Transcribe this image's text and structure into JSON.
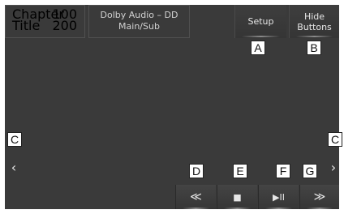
{
  "info": {
    "chapter_label": "Chapter",
    "chapter_value": "100",
    "title_label": "Title",
    "title_value": "200"
  },
  "audio": {
    "line1": "Dolby Audio – DD",
    "line2": "Main/Sub"
  },
  "buttons": {
    "setup": "Setup",
    "hide_line1": "Hide",
    "hide_line2": "Buttons"
  },
  "callouts": {
    "a": "A",
    "b": "B",
    "c_left": "C",
    "c_right": "C",
    "d": "D",
    "e": "E",
    "f": "F",
    "g": "G"
  },
  "icons": {
    "prev_page": "‹",
    "next_page": "›",
    "rewind": "≪",
    "stop": "■",
    "play_pause": "▶II",
    "fast_forward": "≫"
  }
}
